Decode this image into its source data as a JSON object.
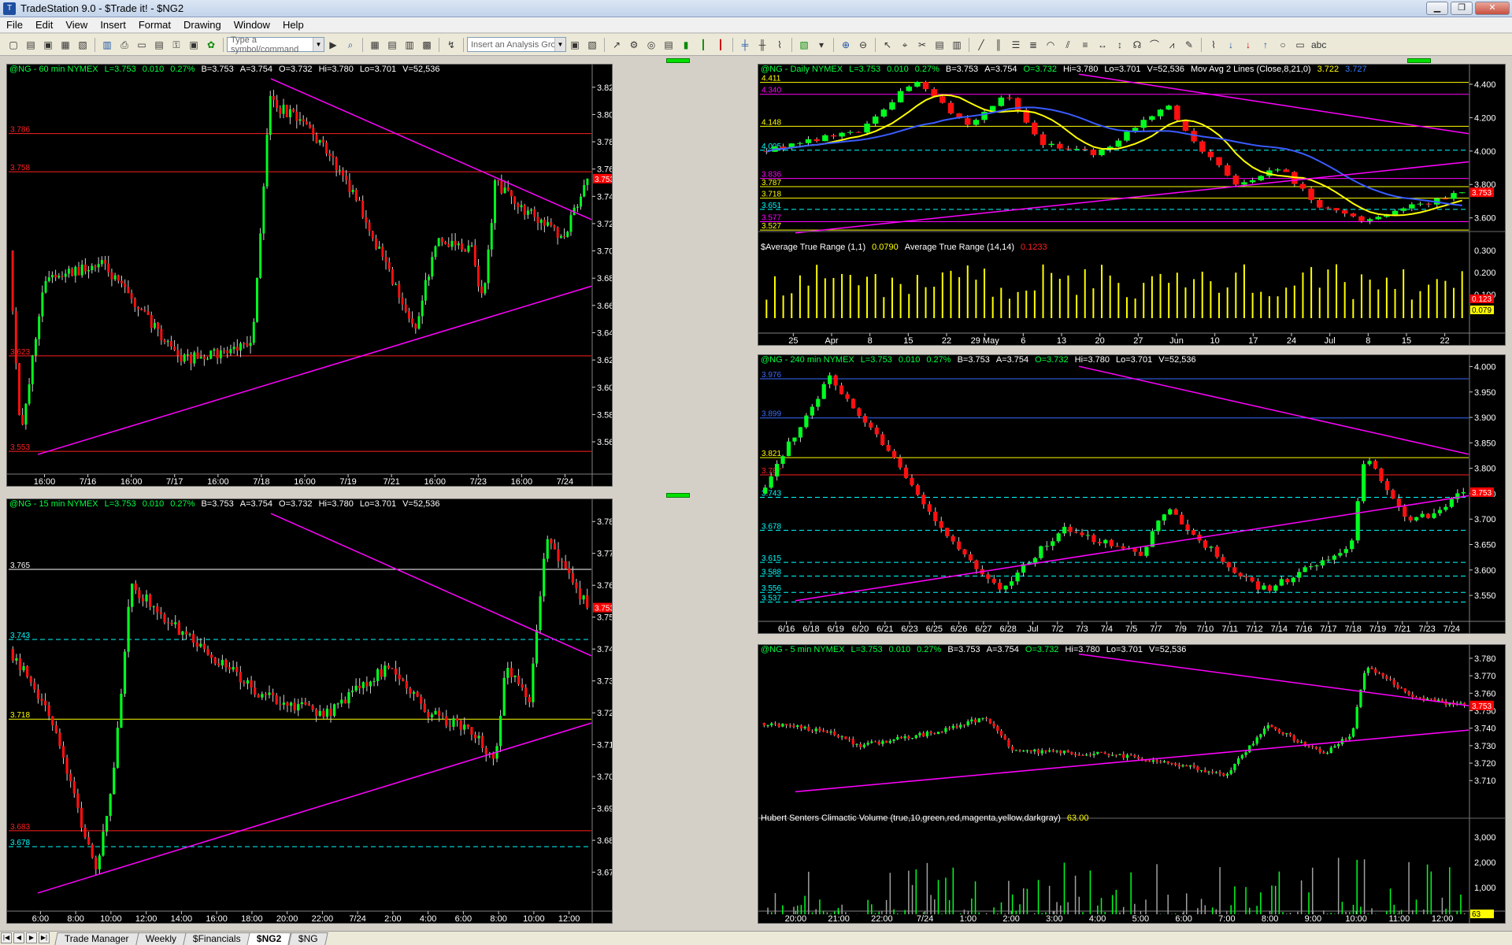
{
  "window": {
    "title": "TradeStation 9.0 - $Trade it! - $NG2",
    "min": "▁",
    "max": "❐",
    "close": "✕"
  },
  "menu": [
    "File",
    "Edit",
    "View",
    "Insert",
    "Format",
    "Drawing",
    "Window",
    "Help"
  ],
  "toolbar": {
    "symbol_placeholder": "Type a symbol/command",
    "analysis_placeholder": "Insert an Analysis Group"
  },
  "tabs": [
    "Trade Manager",
    "Weekly",
    "$Financials",
    "$NG2",
    "$NG"
  ],
  "active_tab": "$NG2",
  "quote": {
    "l": "L=3.753",
    "chg": "0.010",
    "pct": "0.27%",
    "b": "B=3.753",
    "a": "A=3.754",
    "o": "O=3.732",
    "hi": "Hi=3.780",
    "lo": "Lo=3.701",
    "v": "V=52,536"
  },
  "chart_data": [
    {
      "id": "p60",
      "type": "candlestick",
      "symbol": "@NG - 60 min  NYMEX",
      "ylim": [
        3.545,
        3.832
      ],
      "yticks": [
        "3.820",
        "3.800",
        "3.780",
        "3.760",
        "3.740",
        "3.720",
        "3.700",
        "3.680",
        "3.660",
        "3.640",
        "3.620",
        "3.600",
        "3.580",
        "3.560"
      ],
      "xticks": [
        "16:00",
        "7/16",
        "16:00",
        "7/17",
        "16:00",
        "7/18",
        "16:00",
        "7/19",
        "7/21",
        "16:00",
        "7/23",
        "16:00",
        "7/24"
      ],
      "levels": [
        {
          "v": "3.786",
          "c": "#ff2020"
        },
        {
          "v": "3.758",
          "c": "#ff2020"
        },
        {
          "v": "3.623",
          "c": "#ff2020"
        },
        {
          "v": "3.553",
          "c": "#ff2020"
        }
      ],
      "last": "3.753"
    },
    {
      "id": "pD",
      "type": "candlestick",
      "symbol": "@NG - Daily  NYMEX",
      "study": "Mov Avg 2 Lines (Close,8,21,0)",
      "study_v1": "3.722",
      "study_v2": "3.727",
      "ylim": [
        3.49,
        4.48
      ],
      "yticks": [
        "4.400",
        "4.200",
        "4.000",
        "3.800",
        "3.600"
      ],
      "xticks": [
        "25",
        "Apr",
        "8",
        "15",
        "22",
        "29 May",
        "6",
        "13",
        "20",
        "27",
        "Jun",
        "10",
        "17",
        "24",
        "Jul",
        "8",
        "15",
        "22"
      ],
      "levels": [
        {
          "v": "4.411",
          "c": "#ffff00"
        },
        {
          "v": "4.340",
          "c": "#ff00ff"
        },
        {
          "v": "4.148",
          "c": "#ffff00"
        },
        {
          "v": "4.005",
          "c": "#00ffff"
        },
        {
          "v": "3.836",
          "c": "#ff00ff"
        },
        {
          "v": "3.787",
          "c": "#ffff00"
        },
        {
          "v": "3.718",
          "c": "#ffff00"
        },
        {
          "v": "3.651",
          "c": "#00ffff"
        },
        {
          "v": "3.577",
          "c": "#ff00ff"
        },
        {
          "v": "3.527",
          "c": "#ffff00"
        }
      ],
      "last": "3.753",
      "sub": {
        "label1": "$Average True Range (1,1)",
        "val1": "0.0790",
        "label2": "Average True Range (14,14)",
        "val2": "0.1233",
        "yticks": [
          "0.300",
          "0.200",
          "0.100"
        ],
        "tag1": "0.123",
        "tag2": "0.079"
      }
    },
    {
      "id": "p240",
      "type": "candlestick",
      "symbol": "@NG - 240 min  NYMEX",
      "ylim": [
        3.53,
        4.01
      ],
      "yticks": [
        "4.000",
        "3.950",
        "3.900",
        "3.850",
        "3.800",
        "3.750",
        "3.700",
        "3.650",
        "3.600",
        "3.550"
      ],
      "xticks": [
        "6/16",
        "6/18",
        "6/19",
        "6/20",
        "6/21",
        "6/23",
        "6/25",
        "6/26",
        "6/27",
        "6/28",
        "Jul",
        "7/2",
        "7/3",
        "7/4",
        "7/5",
        "7/7",
        "7/9",
        "7/10",
        "7/11",
        "7/12",
        "7/14",
        "7/16",
        "7/17",
        "7/18",
        "7/19",
        "7/21",
        "7/23",
        "7/24"
      ],
      "levels": [
        {
          "v": "3.976",
          "c": "#3a6cff"
        },
        {
          "v": "3.899",
          "c": "#3a6cff"
        },
        {
          "v": "3.821",
          "c": "#ffff00"
        },
        {
          "v": "3.787",
          "c": "#ff2020"
        },
        {
          "v": "3.743",
          "c": "#00ffff"
        },
        {
          "v": "3.678",
          "c": "#00ffff"
        },
        {
          "v": "3.615",
          "c": "#00ffff"
        },
        {
          "v": "3.588",
          "c": "#00ffff"
        },
        {
          "v": "3.556",
          "c": "#00ffff"
        },
        {
          "v": "3.537",
          "c": "#00ffff"
        }
      ],
      "last": "3.753"
    },
    {
      "id": "p15",
      "type": "candlestick",
      "symbol": "@NG - 15 min  NYMEX",
      "ylim": [
        3.661,
        3.785
      ],
      "yticks": [
        "3.780",
        "3.770",
        "3.760",
        "3.750",
        "3.740",
        "3.730",
        "3.720",
        "3.710",
        "3.700",
        "3.690",
        "3.680",
        "3.670"
      ],
      "xticks": [
        "6:00",
        "8:00",
        "10:00",
        "12:00",
        "14:00",
        "16:00",
        "18:00",
        "20:00",
        "22:00",
        "7/24",
        "2:00",
        "4:00",
        "6:00",
        "8:00",
        "10:00",
        "12:00"
      ],
      "levels": [
        {
          "v": "3.765",
          "c": "#ffffff"
        },
        {
          "v": "3.743",
          "c": "#00ffff"
        },
        {
          "v": "3.718",
          "c": "#ffff00"
        },
        {
          "v": "3.683",
          "c": "#ff2020"
        },
        {
          "v": "3.678",
          "c": "#00ffff"
        }
      ],
      "last": "3.753"
    },
    {
      "id": "p5",
      "type": "candlestick",
      "symbol": "@NG - 5 min  NYMEX",
      "ylim": [
        3.702,
        3.784
      ],
      "yticks": [
        "3.780",
        "3.770",
        "3.760",
        "3.750",
        "3.740",
        "3.730",
        "3.720",
        "3.710"
      ],
      "xticks": [
        "20:00",
        "21:00",
        "22:00",
        "7/24",
        "1:00",
        "2:00",
        "3:00",
        "4:00",
        "5:00",
        "6:00",
        "7:00",
        "8:00",
        "9:00",
        "10:00",
        "11:00",
        "12:00"
      ],
      "last": "3.753",
      "sub": {
        "label": "Hubert Senters Climactic Volume (true,10,green,red,magenta,yellow,darkgray)",
        "val": "63.00",
        "yticks": [
          "3,000",
          "2,000",
          "1,000"
        ],
        "tag": "63"
      }
    }
  ]
}
